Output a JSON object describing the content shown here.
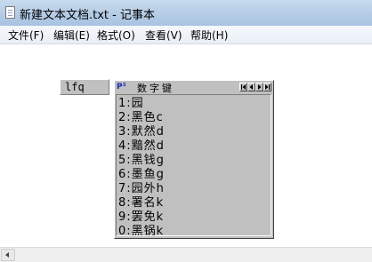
{
  "window": {
    "title": "新建文本文档.txt - 记事本"
  },
  "menubar": {
    "items": [
      {
        "label": "文件(F)"
      },
      {
        "label": "编辑(E)"
      },
      {
        "label": "格式(O)"
      },
      {
        "label": "查看(V)"
      },
      {
        "label": "帮助(H)"
      }
    ]
  },
  "ime": {
    "typed_text": "lfq",
    "mode_title": "数字键",
    "logo": "P³",
    "nav_buttons": [
      "first-page-icon",
      "prev-page-icon",
      "next-page-icon",
      "last-page-icon"
    ],
    "candidates": [
      {
        "num": "1",
        "text": "园"
      },
      {
        "num": "2",
        "text": "黑色c"
      },
      {
        "num": "3",
        "text": "默然d"
      },
      {
        "num": "4",
        "text": "黯然d"
      },
      {
        "num": "5",
        "text": "黑钱g"
      },
      {
        "num": "6",
        "text": "墨鱼g"
      },
      {
        "num": "7",
        "text": "园外h"
      },
      {
        "num": "8",
        "text": "署名k"
      },
      {
        "num": "9",
        "text": "罢免k"
      },
      {
        "num": "0",
        "text": "黑锅k"
      }
    ]
  },
  "colors": {
    "titlebar": "#b5cce6",
    "menubar": "#eef2f8",
    "ime_bg": "#c0c0c0",
    "logo": "#1a2fb5"
  }
}
